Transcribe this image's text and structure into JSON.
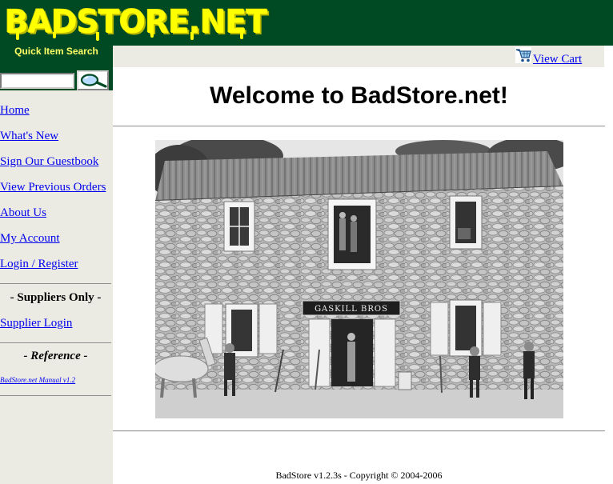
{
  "header": {
    "logo_text": "BADSTORE.NET"
  },
  "search": {
    "label": "Quick Item Search",
    "value": "",
    "placeholder": ""
  },
  "nav": {
    "items": [
      {
        "label": "Home"
      },
      {
        "label": "What's New"
      },
      {
        "label": "Sign Our Guestbook"
      },
      {
        "label": "View Previous Orders"
      },
      {
        "label": "About Us"
      },
      {
        "label": "My Account"
      },
      {
        "label": "Login / Register"
      }
    ]
  },
  "suppliers": {
    "heading": "- Suppliers Only -",
    "login_label": "Supplier Login"
  },
  "reference": {
    "heading": "- Reference -",
    "manual_label": "BadStore.net Manual v1.2"
  },
  "cart": {
    "label": "View Cart"
  },
  "main": {
    "title": "Welcome to BadStore.net!",
    "photo_sign": "GASKILL BROS"
  },
  "footer": {
    "text": "BadStore v1.2.3s - Copyright © 2004-2006"
  },
  "colors": {
    "header_bg": "#004a23",
    "logo": "#ffff00",
    "search_label": "#ffff66",
    "sidebar_bg": "#ecebe3",
    "link": "#0000ee"
  },
  "icons": {
    "search_button": "magnifier-icon",
    "cart": "shopping-cart-icon"
  }
}
